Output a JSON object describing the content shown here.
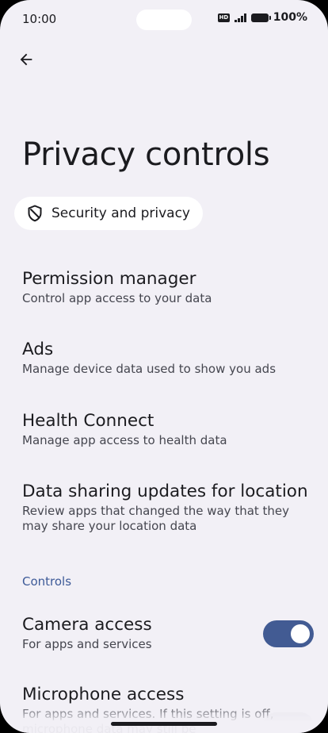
{
  "status_bar": {
    "time": "10:00",
    "hd_badge": "HD",
    "battery": "100%"
  },
  "header": {
    "back_icon": "arrow-left-icon",
    "title": "Privacy controls"
  },
  "breadcrumb": {
    "icon": "shield-icon",
    "label": "Security and privacy"
  },
  "items": [
    {
      "title": "Permission manager",
      "subtitle": "Control app access to your data"
    },
    {
      "title": "Ads",
      "subtitle": "Manage device data used to show you ads"
    },
    {
      "title": "Health Connect",
      "subtitle": "Manage app access to health data"
    },
    {
      "title": "Data sharing updates for location",
      "subtitle": "Review apps that changed the way that they may share your location data"
    }
  ],
  "controls": {
    "header": "Controls",
    "camera": {
      "title": "Camera access",
      "subtitle": "For apps and services",
      "enabled": true
    },
    "microphone": {
      "title": "Microphone access",
      "subtitle": "For apps and services. If this setting is off, microphone data may still be"
    }
  },
  "colors": {
    "background": "#f2f0f6",
    "accent": "#425b93",
    "section_header": "#3d5a98",
    "text_primary": "#1b1b1f",
    "text_secondary": "#45464f"
  }
}
